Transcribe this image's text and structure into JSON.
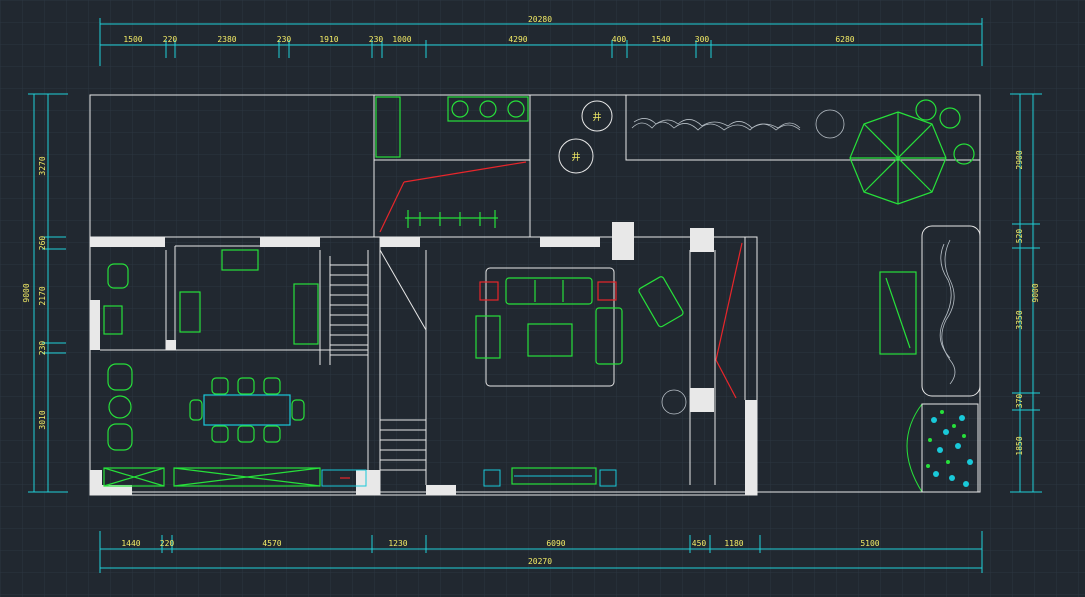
{
  "colors": {
    "background": "#212830",
    "grid": "#2c3641",
    "wall": "#e8e8e8",
    "dimension": "#1fd0d8",
    "dimension_text": "#f3ec66",
    "furniture": "#27e03a",
    "accent_cyan": "#19c9d9",
    "accent_red": "#e8262b",
    "accent_yellow": "#f3ec66"
  },
  "dimensions": {
    "top_total": "20280",
    "top_segments": [
      "1500",
      "220",
      "2380",
      "230",
      "1910",
      "230",
      "1000",
      "4290",
      "400",
      "1540",
      "300",
      "6280"
    ],
    "bottom_total": "20270",
    "bottom_segments": [
      "1440",
      "220",
      "4570",
      "1230",
      "6090",
      "450",
      "1180",
      "5100"
    ],
    "left_total": "9000",
    "left_segments": [
      "3270",
      "260",
      "2170",
      "230",
      "3010"
    ],
    "right_total": "9000",
    "right_segments": [
      "2900",
      "520",
      "3350",
      "370",
      "1850"
    ]
  },
  "symbols": {
    "well_a": "井",
    "well_b": "井"
  }
}
